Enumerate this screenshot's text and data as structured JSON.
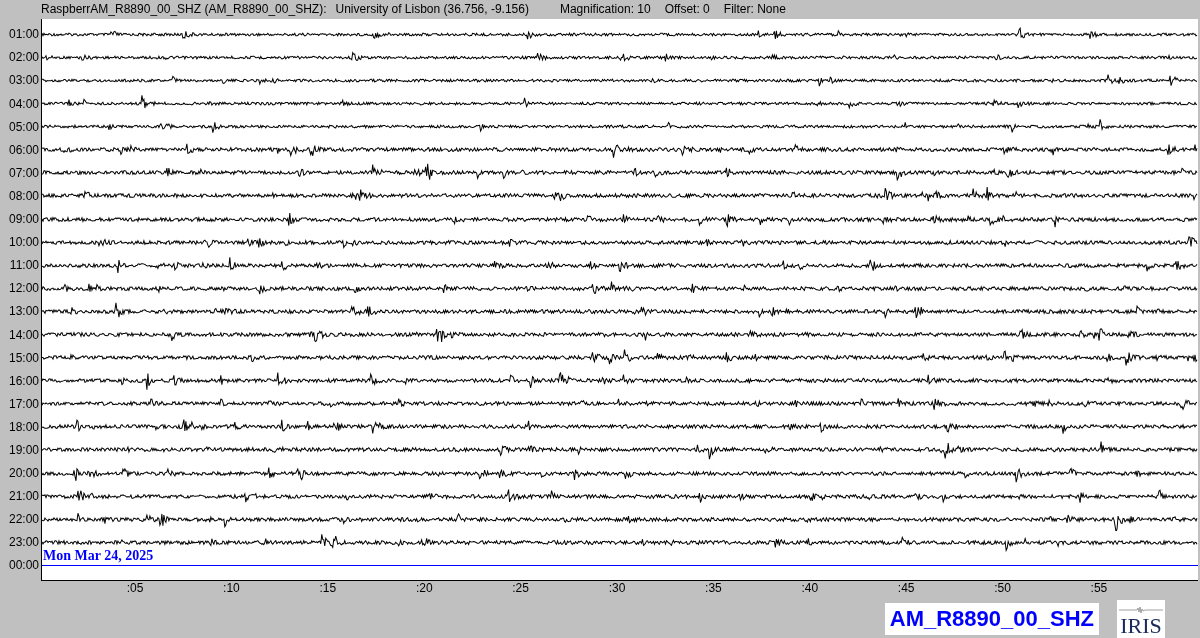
{
  "header": {
    "station": "RaspberrAM_R8890_00_SHZ (AM_R8890_00_SHZ):",
    "location": "University of Lisbon (36.756, -9.156)",
    "magnification": "Magnification: 10",
    "offset": "Offset: 0",
    "filter": "Filter: None"
  },
  "rows": [
    {
      "label": "01:00",
      "kind": "trace"
    },
    {
      "label": "02:00",
      "kind": "trace"
    },
    {
      "label": "03:00",
      "kind": "trace"
    },
    {
      "label": "04:00",
      "kind": "trace"
    },
    {
      "label": "05:00",
      "kind": "trace"
    },
    {
      "label": "06:00",
      "kind": "trace"
    },
    {
      "label": "07:00",
      "kind": "trace"
    },
    {
      "label": "08:00",
      "kind": "trace"
    },
    {
      "label": "09:00",
      "kind": "trace"
    },
    {
      "label": "10:00",
      "kind": "trace"
    },
    {
      "label": "11:00",
      "kind": "trace"
    },
    {
      "label": "12:00",
      "kind": "trace"
    },
    {
      "label": "13:00",
      "kind": "trace"
    },
    {
      "label": "14:00",
      "kind": "trace"
    },
    {
      "label": "15:00",
      "kind": "trace"
    },
    {
      "label": "16:00",
      "kind": "trace"
    },
    {
      "label": "17:00",
      "kind": "trace"
    },
    {
      "label": "18:00",
      "kind": "trace"
    },
    {
      "label": "19:00",
      "kind": "trace"
    },
    {
      "label": "20:00",
      "kind": "trace"
    },
    {
      "label": "21:00",
      "kind": "trace"
    },
    {
      "label": "22:00",
      "kind": "trace"
    },
    {
      "label": "23:00",
      "kind": "trace"
    },
    {
      "label": "00:00",
      "kind": "marker",
      "date": "Mon Mar 24, 2025"
    }
  ],
  "x_ticks": [
    ":05",
    ":10",
    ":15",
    ":20",
    ":25",
    ":30",
    ":35",
    ":40",
    ":45",
    ":50",
    ":55"
  ],
  "station_label": "AM_R8890_00_SHZ",
  "logo": {
    "text": "IRIS"
  }
}
